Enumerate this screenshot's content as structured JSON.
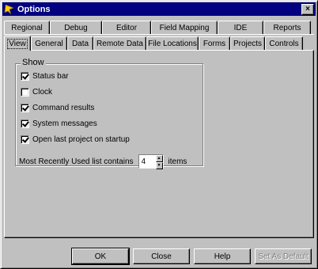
{
  "window": {
    "title": "Options",
    "close_glyph": "×"
  },
  "tabs_row1": [
    {
      "label": "Regional"
    },
    {
      "label": "Debug"
    },
    {
      "label": "Editor"
    },
    {
      "label": "Field Mapping"
    },
    {
      "label": "IDE"
    },
    {
      "label": "Reports"
    }
  ],
  "tabs_row2": [
    {
      "label": "View",
      "active": true
    },
    {
      "label": "General"
    },
    {
      "label": "Data"
    },
    {
      "label": "Remote Data"
    },
    {
      "label": "File Locations"
    },
    {
      "label": "Forms"
    },
    {
      "label": "Projects"
    },
    {
      "label": "Controls"
    }
  ],
  "show_group": {
    "label": "Show",
    "options": [
      {
        "label": "Status bar",
        "checked": true
      },
      {
        "label": "Clock",
        "checked": false
      },
      {
        "label": "Command results",
        "checked": true
      },
      {
        "label": "System messages",
        "checked": true
      },
      {
        "label": "Open last project on startup",
        "checked": true
      }
    ]
  },
  "mru": {
    "label": "Most Recently Used list contains",
    "value": "4",
    "suffix": "items"
  },
  "buttons": {
    "ok": "OK",
    "close": "Close",
    "help": "Help",
    "set_default": "Set As Default"
  }
}
